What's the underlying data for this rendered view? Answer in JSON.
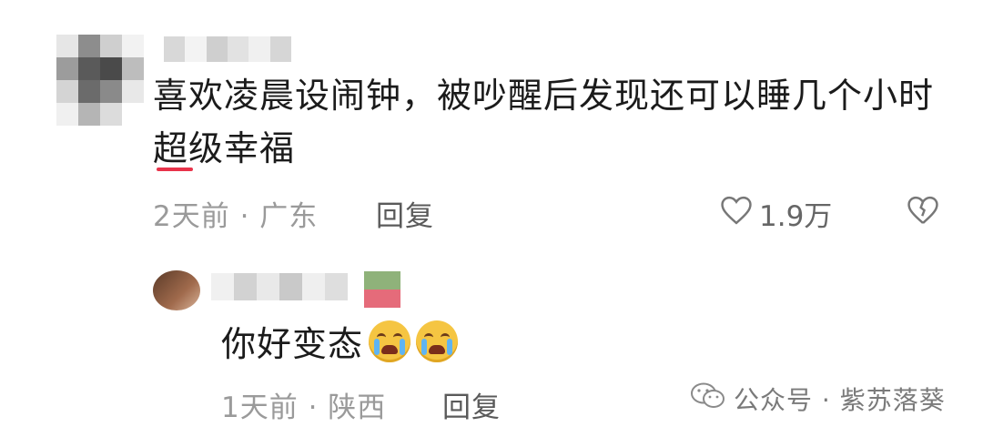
{
  "comment": {
    "text": "喜欢凌晨设闹钟，被吵醒后发现还可以睡几个小时超级幸福",
    "time_location": "2天前 · 广东",
    "reply_label": "回复",
    "likes": "1.9万"
  },
  "reply": {
    "text": "你好变态",
    "emojis": [
      "crying-emoji",
      "crying-emoji"
    ],
    "time_location": "1天前 · 陕西",
    "reply_label": "回复"
  },
  "watermark": {
    "text": "公众号 · 紫苏落葵"
  },
  "colors": {
    "text": "#1b1b1b",
    "meta": "#9a9a9a",
    "accent": "#e8334a"
  }
}
